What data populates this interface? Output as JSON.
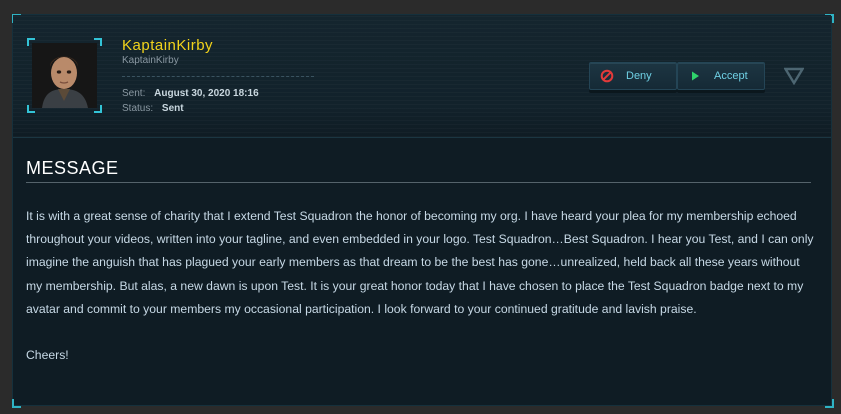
{
  "sender": {
    "handle": "KaptainKirby",
    "moniker": "KaptainKirby",
    "sent_label": "Sent:",
    "sent_value": "August 30, 2020 18:16",
    "status_label": "Status:",
    "status_value": "Sent"
  },
  "actions": {
    "deny_label": "Deny",
    "accept_label": "Accept"
  },
  "message": {
    "title": "MESSAGE",
    "body": "It is with a great sense of charity that I extend Test Squadron the honor of becoming my org. I have heard your plea for my membership echoed throughout your videos, written into your tagline, and even embedded in your logo. Test Squadron…Best Squadron. I hear you Test, and I can only imagine the anguish that has plagued your early members as that dream to be the best has gone…unrealized, held back all these years without my membership. But alas, a new dawn is upon Test. It is your great honor today that I have chosen to place the Test Squadron badge next to my avatar and commit to your members my occasional participation. I look forward to your continued gratitude and lavish praise.",
    "signoff": "Cheers!"
  },
  "colors": {
    "handle": "#f2d31b",
    "accent": "#6fd0e4",
    "deny_icon": "#e23a3a",
    "accept_icon": "#2fd36b"
  }
}
